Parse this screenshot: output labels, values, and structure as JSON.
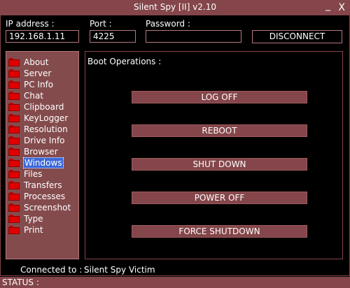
{
  "window": {
    "title": "Silent Spy [II] v2.10",
    "minimize_glyph": "_",
    "close_glyph": "X"
  },
  "connection": {
    "ip_label": "IP address :",
    "ip_value": "192.168.1.11",
    "port_label": "Port :",
    "port_value": "4225",
    "password_label": "Password :",
    "password_value": "",
    "disconnect_label": "DISCONNECT"
  },
  "sidebar": {
    "items": [
      {
        "label": "About",
        "selected": false
      },
      {
        "label": "Server",
        "selected": false
      },
      {
        "label": "PC Info",
        "selected": false
      },
      {
        "label": "Chat",
        "selected": false
      },
      {
        "label": "Clipboard",
        "selected": false
      },
      {
        "label": "KeyLogger",
        "selected": false
      },
      {
        "label": "Resolution",
        "selected": false
      },
      {
        "label": "Drive Info",
        "selected": false
      },
      {
        "label": "Browser",
        "selected": false
      },
      {
        "label": "Windows",
        "selected": true
      },
      {
        "label": "Files",
        "selected": false
      },
      {
        "label": "Transfers",
        "selected": false
      },
      {
        "label": "Processes",
        "selected": false
      },
      {
        "label": "Screenshot",
        "selected": false
      },
      {
        "label": "Type",
        "selected": false
      },
      {
        "label": "Print",
        "selected": false
      }
    ],
    "folder_icon": "folder-icon"
  },
  "main": {
    "section_title": "Boot Operations :",
    "buttons": [
      {
        "label": "LOG OFF"
      },
      {
        "label": "REBOOT"
      },
      {
        "label": "SHUT DOWN"
      },
      {
        "label": "POWER OFF"
      },
      {
        "label": "FORCE SHUTDOWN"
      }
    ]
  },
  "footer": {
    "connected_label": "Connected to :",
    "connected_value": "Silent Spy Victim",
    "status_label": "STATUS :"
  },
  "colors": {
    "accent": "#84464a",
    "border": "#b6787c",
    "background": "#000000",
    "selection": "#3c68d8",
    "folder_red": "#e00000"
  }
}
